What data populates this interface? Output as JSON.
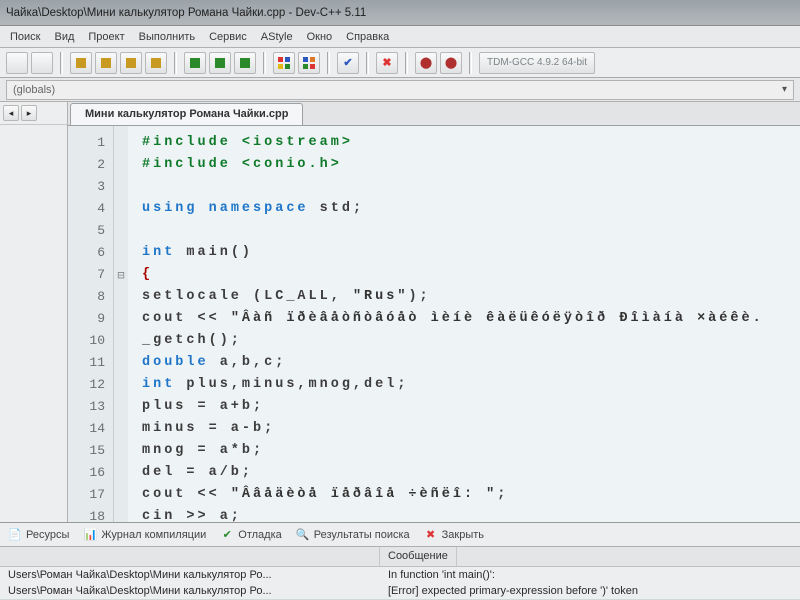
{
  "window": {
    "title": "Чайка\\Desktop\\Мини калькулятор Романа Чайки.cpp - Dev-C++ 5.11"
  },
  "menu": {
    "items": [
      "Поиск",
      "Вид",
      "Проект",
      "Выполнить",
      "Сервис",
      "AStyle",
      "Окно",
      "Справка"
    ]
  },
  "toolbar": {
    "compiler": "TDM-GCC 4.9.2 64-bit"
  },
  "scope": {
    "label": "(globals)"
  },
  "tabs": {
    "active": "Мини калькулятор Романа Чайки.cpp"
  },
  "code": {
    "lines": [
      {
        "n": "1",
        "html": "<span class='pre'>#include</span> <span class='pre'>&lt;iostream&gt;</span>"
      },
      {
        "n": "2",
        "html": "<span class='pre'>#include</span> <span class='pre'>&lt;conio.h&gt;</span>"
      },
      {
        "n": "3",
        "html": ""
      },
      {
        "n": "4",
        "html": "<span class='kw'>using</span> <span class='kw'>namespace</span> std;"
      },
      {
        "n": "5",
        "html": ""
      },
      {
        "n": "6",
        "html": "<span class='typ'>int</span> main()"
      },
      {
        "n": "7",
        "html": "<span class='br'>{</span>",
        "fold": "⊟"
      },
      {
        "n": "8",
        "html": "setlocale (LC_ALL, <span class='str'>\"Rus\"</span>);"
      },
      {
        "n": "9",
        "html": "cout &lt;&lt; <span class='str'>\"Âàñ ïðèâåòñòâóåò ìèíè êàëüêóëÿòîð Ðîìàíà ×àéêè.</span>"
      },
      {
        "n": "10",
        "html": "_getch();"
      },
      {
        "n": "11",
        "html": "<span class='typ'>double</span> a,b,c;"
      },
      {
        "n": "12",
        "html": "<span class='typ'>int</span> plus,minus,mnog,del;"
      },
      {
        "n": "13",
        "html": "plus = a+b;"
      },
      {
        "n": "14",
        "html": "minus = a-b;"
      },
      {
        "n": "15",
        "html": "mnog = a*b;"
      },
      {
        "n": "16",
        "html": "del = a/b;"
      },
      {
        "n": "17",
        "html": "cout &lt;&lt; <span class='str'>\"Ââåäèòå ïåðâîå ÷èñëî: \"</span>;"
      },
      {
        "n": "18",
        "html": "cin &gt;&gt; a;"
      }
    ]
  },
  "panels": {
    "tabs": [
      "Ресурсы",
      "Журнал компиляции",
      "Отладка",
      "Результаты поиска",
      "Закрыть"
    ]
  },
  "messages": {
    "header": {
      "file": "",
      "msg": "Сообщение"
    },
    "rows": [
      {
        "file": "Users\\Роман Чайка\\Desktop\\Мини калькулятор Ро...",
        "msg": "In function 'int main()':"
      },
      {
        "file": "Users\\Роман Чайка\\Desktop\\Мини калькулятор Ро...",
        "msg": "[Error] expected primary-expression before ')' token"
      }
    ]
  },
  "colors": {
    "red": "#d33",
    "green": "#2a8a2a",
    "blue": "#2a57c0",
    "yellow": "#e3b814",
    "orange": "#e07728",
    "purple": "#7a3aa0"
  }
}
